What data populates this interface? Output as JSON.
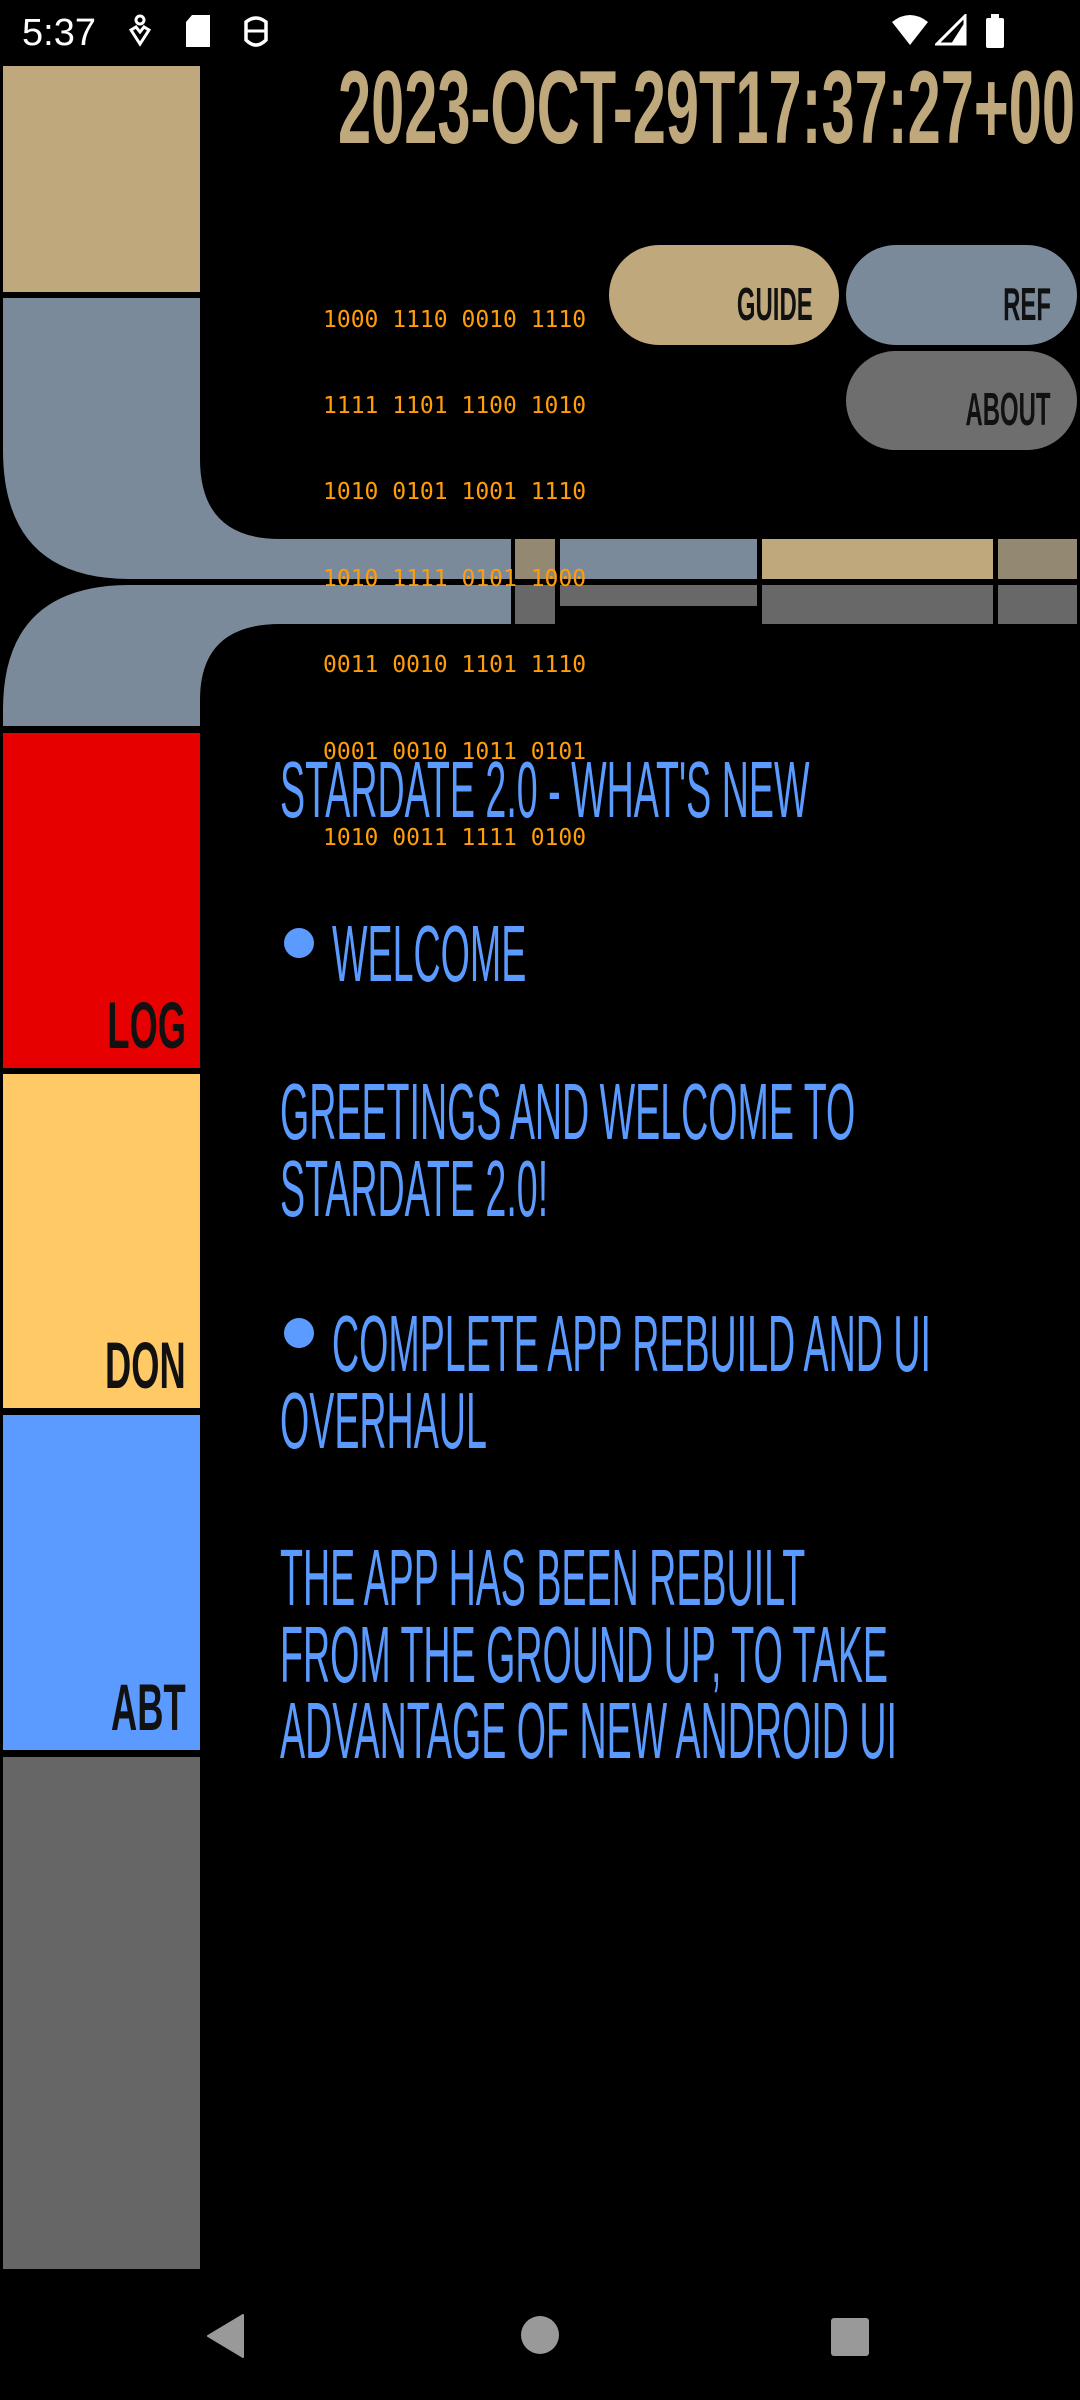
{
  "status_bar": {
    "time": "5:37",
    "left_icons": [
      "accessibility-icon",
      "sd-card-icon",
      "debug-icon"
    ],
    "right_icons": [
      "wifi-icon",
      "signal-icon",
      "battery-icon"
    ]
  },
  "header": {
    "timestamp": "2023-OCT-29T17:37:27+00",
    "binary_lines": [
      "1000 1110 0010 1110",
      "1111 1101 1100 1010",
      "1010 0101 1001 1110",
      "1010 1111 0101 1000",
      "0011 0010 1101 1110",
      "0001 0010 1011 0101",
      "1010 0011 1111 0100"
    ],
    "buttons": {
      "guide": "GUIDE",
      "ref": "REF",
      "about": "ABOUT"
    }
  },
  "sidebar": {
    "items": [
      {
        "label": "LOG",
        "color": "#e60000"
      },
      {
        "label": "DON",
        "color": "#ffc966"
      },
      {
        "label": "ABT",
        "color": "#5b9bff"
      }
    ]
  },
  "content": {
    "title": "STARDATE 2.0 - WHAT'S NEW",
    "section1_heading": "WELCOME",
    "section1_lines": [
      "GREETINGS AND WELCOME TO",
      "STARDATE 2.0!"
    ],
    "section2_heading_lines": [
      "COMPLETE APP REBUILD AND UI",
      "OVERHAUL"
    ],
    "section2_lines": [
      "THE APP HAS BEEN REBUILT",
      "FROM THE GROUND UP, TO TAKE",
      "ADVANTAGE OF NEW ANDROID UI"
    ]
  },
  "colors": {
    "tan": "#bfa87c",
    "slate": "#7a8a9a",
    "gray": "#666666",
    "text_blue": "#5b9bff",
    "binary_orange": "#ff9d0a"
  },
  "nav_bar": {
    "icons": [
      "back-icon",
      "home-icon",
      "recents-icon"
    ]
  }
}
